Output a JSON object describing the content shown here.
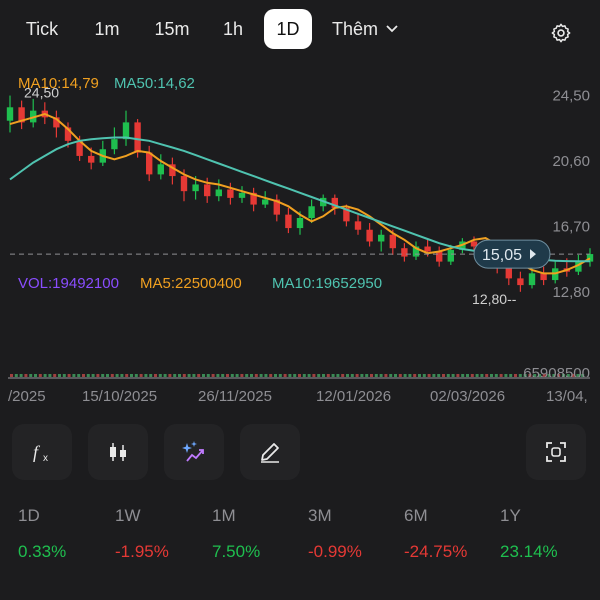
{
  "timeframes": [
    "Tick",
    "1m",
    "15m",
    "1h",
    "1D"
  ],
  "active_timeframe": "1D",
  "more_label": "Thêm",
  "chart_data": {
    "type": "line",
    "title": "",
    "price_axis_labels": [
      "24,50",
      "20,60",
      "16,70",
      "12,80"
    ],
    "y_ticks": [
      24.5,
      20.6,
      16.7,
      12.8
    ],
    "ylim": [
      11.0,
      26.5
    ],
    "x_tick_labels": [
      "/2025",
      "15/10/2025",
      "26/11/2025",
      "12/01/2026",
      "02/03/2026",
      "13/04,"
    ],
    "ma_legend": {
      "ma10": "MA10:14,79",
      "ma50": "MA50:14,62"
    },
    "high_label": "24,50",
    "low_label": "12,80--",
    "current_price_label": "15,05",
    "current_price": 15.05,
    "series": [
      {
        "name": "MA10",
        "color": "#f0a020",
        "values": [
          22.8,
          23.0,
          23.2,
          23.4,
          23.1,
          22.5,
          21.8,
          21.2,
          20.9,
          20.7,
          20.9,
          21.2,
          21.1,
          20.6,
          20.2,
          19.8,
          19.5,
          19.3,
          19.2,
          19.0,
          18.8,
          18.6,
          18.4,
          18.2,
          17.9,
          17.4,
          17.0,
          17.3,
          17.8,
          17.9,
          17.7,
          17.3,
          16.8,
          16.3,
          15.9,
          15.4,
          15.1,
          15.2,
          15.4,
          15.6,
          15.9,
          16.0,
          15.6,
          15.1,
          14.5,
          14.1,
          13.9,
          13.9,
          14.1,
          14.4,
          14.79
        ]
      },
      {
        "name": "MA50",
        "color": "#4fc3b0",
        "values": [
          19.5,
          20.0,
          20.5,
          20.9,
          21.3,
          21.6,
          21.8,
          21.9,
          21.95,
          22.0,
          22.0,
          21.9,
          21.8,
          21.6,
          21.4,
          21.2,
          20.95,
          20.7,
          20.45,
          20.2,
          19.95,
          19.7,
          19.45,
          19.2,
          18.95,
          18.7,
          18.45,
          18.2,
          17.95,
          17.7,
          17.45,
          17.2,
          16.95,
          16.7,
          16.45,
          16.2,
          15.95,
          15.7,
          15.5,
          15.35,
          15.25,
          15.15,
          15.05,
          14.95,
          14.85,
          14.75,
          14.7,
          14.65,
          14.63,
          14.62,
          14.62
        ]
      }
    ],
    "candles": [
      {
        "o": 23.0,
        "c": 23.8,
        "h": 24.5,
        "l": 22.3
      },
      {
        "o": 23.8,
        "c": 22.9,
        "h": 24.2,
        "l": 22.5
      },
      {
        "o": 22.9,
        "c": 23.6,
        "h": 24.3,
        "l": 22.6
      },
      {
        "o": 23.6,
        "c": 23.2,
        "h": 24.1,
        "l": 22.8
      },
      {
        "o": 23.2,
        "c": 22.6,
        "h": 23.6,
        "l": 22.0
      },
      {
        "o": 22.6,
        "c": 21.8,
        "h": 22.9,
        "l": 21.4
      },
      {
        "o": 21.8,
        "c": 20.9,
        "h": 22.1,
        "l": 20.6
      },
      {
        "o": 20.9,
        "c": 20.5,
        "h": 21.4,
        "l": 20.1
      },
      {
        "o": 20.5,
        "c": 21.3,
        "h": 21.8,
        "l": 20.3
      },
      {
        "o": 21.3,
        "c": 21.9,
        "h": 22.6,
        "l": 21.0
      },
      {
        "o": 21.9,
        "c": 22.9,
        "h": 23.6,
        "l": 21.5
      },
      {
        "o": 22.9,
        "c": 21.1,
        "h": 23.1,
        "l": 20.8
      },
      {
        "o": 21.1,
        "c": 19.8,
        "h": 21.5,
        "l": 19.4
      },
      {
        "o": 19.8,
        "c": 20.4,
        "h": 21.0,
        "l": 19.5
      },
      {
        "o": 20.4,
        "c": 19.7,
        "h": 20.8,
        "l": 19.2
      },
      {
        "o": 19.7,
        "c": 18.8,
        "h": 20.1,
        "l": 18.2
      },
      {
        "o": 18.8,
        "c": 19.2,
        "h": 19.7,
        "l": 18.3
      },
      {
        "o": 19.2,
        "c": 18.5,
        "h": 19.6,
        "l": 18.1
      },
      {
        "o": 18.5,
        "c": 18.9,
        "h": 19.5,
        "l": 18.2
      },
      {
        "o": 18.9,
        "c": 18.4,
        "h": 19.3,
        "l": 18.0
      },
      {
        "o": 18.4,
        "c": 18.7,
        "h": 19.1,
        "l": 18.1
      },
      {
        "o": 18.7,
        "c": 18.0,
        "h": 19.0,
        "l": 17.6
      },
      {
        "o": 18.0,
        "c": 18.3,
        "h": 18.8,
        "l": 17.8
      },
      {
        "o": 18.3,
        "c": 17.4,
        "h": 18.6,
        "l": 17.0
      },
      {
        "o": 17.4,
        "c": 16.6,
        "h": 17.8,
        "l": 16.3
      },
      {
        "o": 16.6,
        "c": 17.2,
        "h": 17.6,
        "l": 16.2
      },
      {
        "o": 17.2,
        "c": 17.9,
        "h": 18.3,
        "l": 16.9
      },
      {
        "o": 17.9,
        "c": 18.4,
        "h": 18.6,
        "l": 17.6
      },
      {
        "o": 18.4,
        "c": 17.8,
        "h": 18.6,
        "l": 17.4
      },
      {
        "o": 17.8,
        "c": 17.0,
        "h": 18.0,
        "l": 16.7
      },
      {
        "o": 17.0,
        "c": 16.5,
        "h": 17.4,
        "l": 16.2
      },
      {
        "o": 16.5,
        "c": 15.8,
        "h": 16.9,
        "l": 15.5
      },
      {
        "o": 15.8,
        "c": 16.2,
        "h": 16.5,
        "l": 15.2
      },
      {
        "o": 16.2,
        "c": 15.4,
        "h": 16.5,
        "l": 15.0
      },
      {
        "o": 15.4,
        "c": 14.9,
        "h": 15.7,
        "l": 14.6
      },
      {
        "o": 14.9,
        "c": 15.5,
        "h": 15.8,
        "l": 14.7
      },
      {
        "o": 15.5,
        "c": 15.2,
        "h": 15.9,
        "l": 14.9
      },
      {
        "o": 15.2,
        "c": 14.6,
        "h": 15.5,
        "l": 14.3
      },
      {
        "o": 14.6,
        "c": 15.3,
        "h": 15.6,
        "l": 14.4
      },
      {
        "o": 15.3,
        "c": 15.8,
        "h": 16.0,
        "l": 15.1
      },
      {
        "o": 15.8,
        "c": 15.5,
        "h": 16.1,
        "l": 15.2
      },
      {
        "o": 15.5,
        "c": 15.0,
        "h": 15.8,
        "l": 14.7
      },
      {
        "o": 15.0,
        "c": 14.2,
        "h": 15.3,
        "l": 13.9
      },
      {
        "o": 14.2,
        "c": 13.6,
        "h": 14.5,
        "l": 13.2
      },
      {
        "o": 13.6,
        "c": 13.2,
        "h": 14.0,
        "l": 12.8
      },
      {
        "o": 13.2,
        "c": 13.9,
        "h": 14.2,
        "l": 13.0
      },
      {
        "o": 13.9,
        "c": 13.5,
        "h": 14.3,
        "l": 13.2
      },
      {
        "o": 13.5,
        "c": 14.2,
        "h": 14.6,
        "l": 13.3
      },
      {
        "o": 14.2,
        "c": 14.0,
        "h": 14.8,
        "l": 13.7
      },
      {
        "o": 14.0,
        "c": 14.6,
        "h": 15.0,
        "l": 13.8
      },
      {
        "o": 14.6,
        "c": 15.05,
        "h": 15.4,
        "l": 14.3
      }
    ],
    "volume": {
      "vol_label": "VOL:19492100",
      "ma5_label": "MA5:22500400",
      "ma10_label": "MA10:19652950",
      "max_label": "65908500"
    }
  },
  "colors": {
    "up": "#1fbf4f",
    "down": "#e53935",
    "ma10": "#f0a020",
    "ma50": "#4fc3b0",
    "vol": "#a070ff"
  },
  "toolbar": {
    "icons": [
      "function-icon",
      "candlestick-icon",
      "ai-sparkle-icon",
      "pencil-icon",
      "fullscreen-icon"
    ]
  },
  "performance": [
    {
      "period": "1D",
      "value": "0.33%",
      "trend": "up"
    },
    {
      "period": "1W",
      "value": "-1.95%",
      "trend": "down"
    },
    {
      "period": "1M",
      "value": "7.50%",
      "trend": "up"
    },
    {
      "period": "3M",
      "value": "-0.99%",
      "trend": "down"
    },
    {
      "period": "6M",
      "value": "-24.75%",
      "trend": "down"
    },
    {
      "period": "1Y",
      "value": "23.14%",
      "trend": "up"
    }
  ]
}
